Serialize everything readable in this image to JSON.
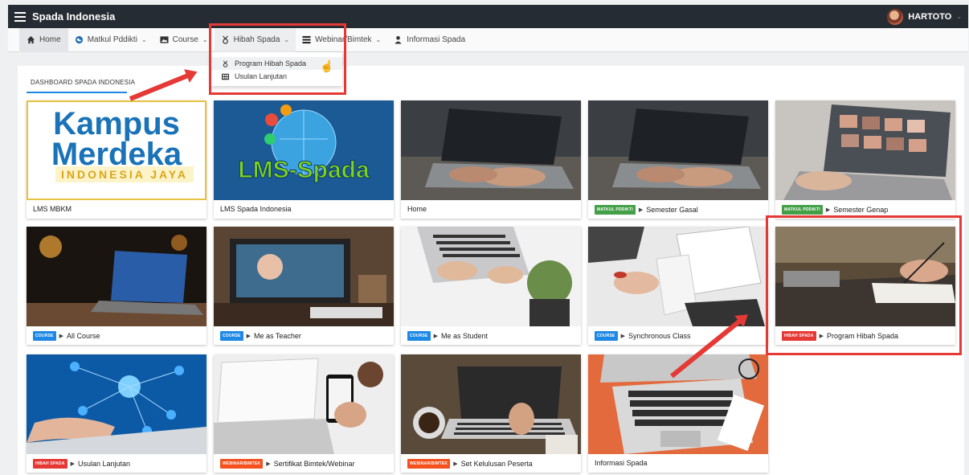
{
  "app": {
    "title": "Spada Indonesia",
    "user": "HARTOTO"
  },
  "menu": [
    {
      "label": "Home",
      "icon": "home-icon"
    },
    {
      "label": "Matkul Pddikti",
      "icon": "globe-icon"
    },
    {
      "label": "Course",
      "icon": "image-icon"
    },
    {
      "label": "Hibah Spada",
      "icon": "medal-icon"
    },
    {
      "label": "Webinar/Bimtek",
      "icon": "list-icon"
    },
    {
      "label": "Informasi Spada",
      "icon": "person-icon"
    }
  ],
  "dropdown": [
    {
      "label": "Program Hibah Spada",
      "icon": "medal-icon"
    },
    {
      "label": "Usulan Lanjutan",
      "icon": "grid-icon"
    }
  ],
  "dashboard": {
    "tab": "DASHBOARD SPADA INDONESIA"
  },
  "cards": [
    {
      "title": "LMS MBKM",
      "badge": "",
      "image": "kampus-merdeka-logo"
    },
    {
      "title": "LMS Spada Indonesia",
      "badge": "",
      "image": "lms-spada-logo"
    },
    {
      "title": "Home",
      "badge": "",
      "image": "laptop-typing-photo"
    },
    {
      "title": "Semester Gasal",
      "badge": "MATKUL PDDIKTI",
      "image": "laptop-typing-photo"
    },
    {
      "title": "Semester Genap",
      "badge": "MATKUL PDDIKTI",
      "image": "laptop-photos-screen"
    },
    {
      "title": "All Course",
      "badge": "COURSE",
      "image": "laptop-desk-night"
    },
    {
      "title": "Me as Teacher",
      "badge": "COURSE",
      "image": "monitor-desk-photo"
    },
    {
      "title": "Me as Student",
      "badge": "COURSE",
      "image": "keyboard-plant-photo"
    },
    {
      "title": "Synchronous Class",
      "badge": "COURSE",
      "image": "notebook-hands-photo"
    },
    {
      "title": "Program Hibah Spada",
      "badge": "HIBAH SPADA",
      "image": "writing-notebook-photo"
    },
    {
      "title": "Usulan Lanjutan",
      "badge": "HIBAH SPADA",
      "image": "network-touch-photo"
    },
    {
      "title": "Sertifikat Bimtek/Webinar",
      "badge": "WEBINAR/BIMTEK",
      "image": "phone-laptop-photo"
    },
    {
      "title": "Set Kelulusan Peserta",
      "badge": "WEBINAR/BIMTEK",
      "image": "laptop-coffee-photo"
    },
    {
      "title": "Informasi Spada",
      "badge": "",
      "image": "laptop-orange-photo"
    }
  ],
  "logos": {
    "kampus_line1": "Kampus",
    "kampus_line2": "Merdeka",
    "kampus_tag": "INDONESIA JAYA",
    "lms_spada": "LMS-Spada"
  },
  "colors": {
    "topbar": "#262c33",
    "accent": "#1e88e5",
    "MATKUL PDDIKTI": "#43a047",
    "COURSE": "#1e88e5",
    "HIBAH SPADA": "#e53935",
    "WEBINAR/BIMTEK": "#f4511e",
    "highlight": "#e53935"
  }
}
